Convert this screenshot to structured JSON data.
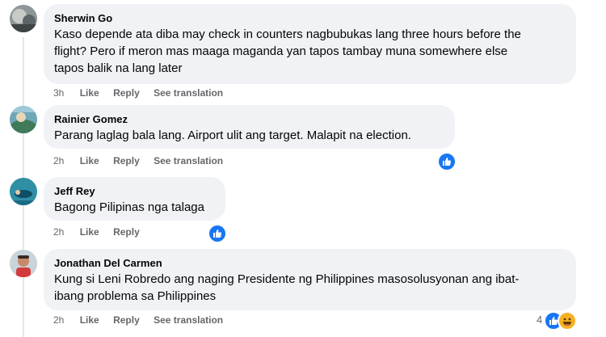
{
  "comments": [
    {
      "author": "Sherwin Go",
      "text_lines": [
        "Kaso depende ata diba may check in counters nagbubukas lang three hours before the",
        "flight? Pero if meron mas maaga maganda yan tapos tambay muna somewhere else",
        "tapos balik na lang later"
      ],
      "time": "3h",
      "like": "Like",
      "reply": "Reply",
      "translate": "See translation"
    },
    {
      "author": "Rainier Gomez",
      "text_lines": [
        "Parang laglag bala lang. Airport ulit ang target. Malapit na election."
      ],
      "time": "2h",
      "like": "Like",
      "reply": "Reply",
      "translate": "See translation",
      "reaction": "like-icon"
    },
    {
      "author": "Jeff Rey",
      "text_lines": [
        "Bagong Pilipinas nga talaga"
      ],
      "time": "2h",
      "like": "Like",
      "reply": "Reply",
      "reaction": "like-icon"
    },
    {
      "author": "Jonathan Del Carmen",
      "text_lines": [
        "Kung si Leni Robredo ang naging Presidente ng Philippines masosolusyonan ang ibat-",
        "ibang problema sa Philippines"
      ],
      "time": "2h",
      "like": "Like",
      "reply": "Reply",
      "translate": "See translation",
      "reaction_count": "4",
      "reactions": [
        "like-icon",
        "haha-icon"
      ]
    }
  ],
  "colors": {
    "bubble": "#f0f2f5",
    "meta": "#65676b",
    "like_blue": "#1877f2",
    "haha_yellow": "#f7b125"
  }
}
